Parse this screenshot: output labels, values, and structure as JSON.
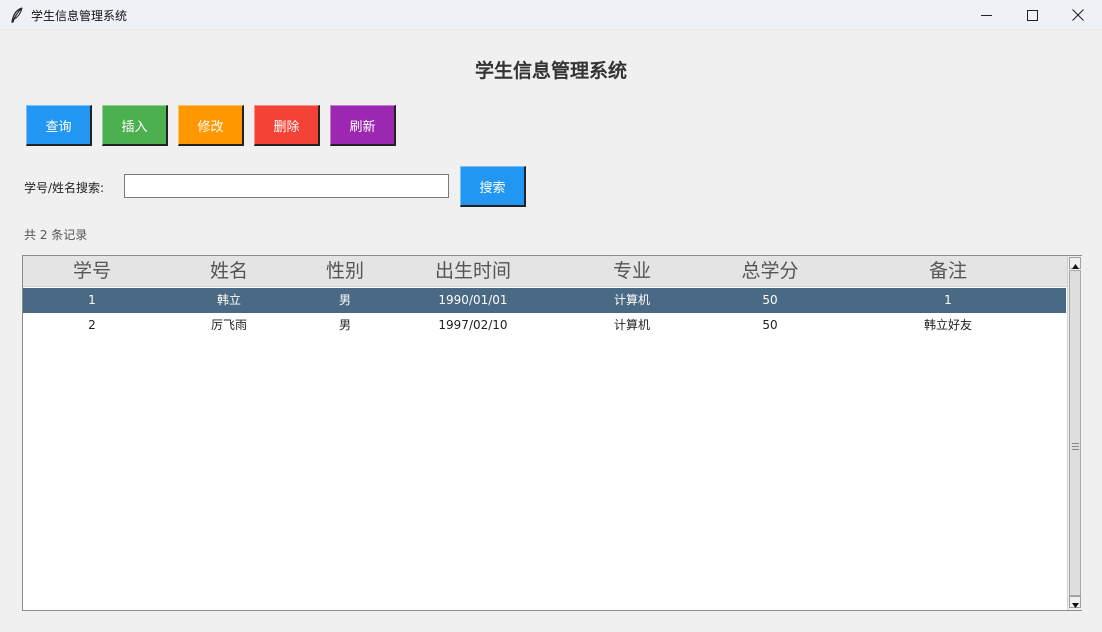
{
  "window": {
    "title": "学生信息管理系统",
    "icon": "feather-icon",
    "controls": [
      "minimize-icon",
      "maximize-icon",
      "close-icon"
    ]
  },
  "heading": "学生信息管理系统",
  "toolbar": {
    "query_label": "查询",
    "insert_label": "插入",
    "edit_label": "修改",
    "delete_label": "删除",
    "refresh_label": "刷新"
  },
  "colors": {
    "query": "#2196f3",
    "insert": "#4caf50",
    "edit": "#ff9800",
    "delete": "#f44336",
    "refresh": "#9c27b0",
    "selected_row": "#4a6984"
  },
  "search": {
    "label": "学号/姓名搜索:",
    "value": "",
    "placeholder": "",
    "button_label": "搜索"
  },
  "record_count": "共 2 条记录",
  "table": {
    "columns": [
      "学号",
      "姓名",
      "性别",
      "出生时间",
      "专业",
      "总学分",
      "备注"
    ],
    "rows": [
      [
        "1",
        "韩立",
        "男",
        "1990/01/01",
        "计算机",
        "50",
        "1"
      ],
      [
        "2",
        "厉飞雨",
        "男",
        "1997/02/10",
        "计算机",
        "50",
        "韩立好友"
      ]
    ],
    "selected_row_index": 0
  }
}
